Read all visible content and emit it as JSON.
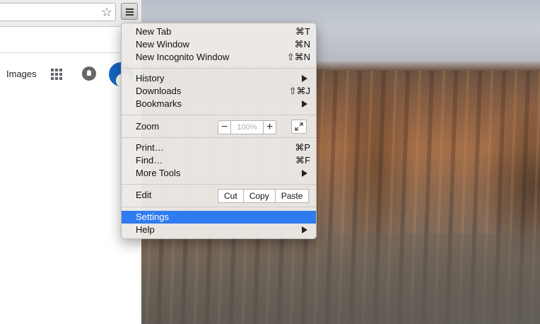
{
  "browser": {
    "omnibox_value": "",
    "bookmark_icon": "star-icon",
    "menu_icon": "hamburger-menu-icon",
    "page": {
      "images_link": "Images",
      "apps_icon": "apps-grid-icon",
      "notifications_icon": "bell-icon",
      "avatar": "account-avatar"
    }
  },
  "menu": {
    "new_tab": {
      "label": "New Tab",
      "shortcut": "⌘T"
    },
    "new_window": {
      "label": "New Window",
      "shortcut": "⌘N"
    },
    "new_incognito": {
      "label": "New Incognito Window",
      "shortcut": "⇧⌘N"
    },
    "history": {
      "label": "History"
    },
    "downloads": {
      "label": "Downloads",
      "shortcut": "⇧⌘J"
    },
    "bookmarks": {
      "label": "Bookmarks"
    },
    "zoom": {
      "label": "Zoom",
      "minus": "−",
      "value": "100%",
      "plus": "+",
      "fullscreen_icon": "fullscreen-icon"
    },
    "print": {
      "label": "Print…",
      "shortcut": "⌘P"
    },
    "find": {
      "label": "Find…",
      "shortcut": "⌘F"
    },
    "more_tools": {
      "label": "More Tools"
    },
    "edit": {
      "label": "Edit",
      "cut": "Cut",
      "copy": "Copy",
      "paste": "Paste"
    },
    "settings": {
      "label": "Settings"
    },
    "help": {
      "label": "Help"
    }
  },
  "colors": {
    "selection": "#2f7bf0",
    "avatar": "#1565c0"
  }
}
